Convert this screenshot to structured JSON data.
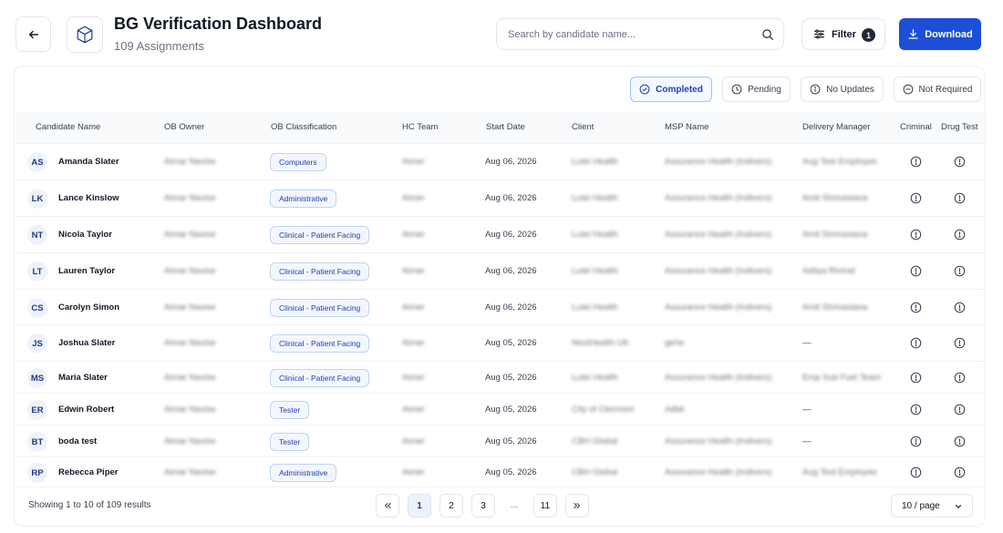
{
  "header": {
    "title": "BG Verification Dashboard",
    "subtitle": "109 Assignments",
    "search_placeholder": "Search by candidate name...",
    "filter_label": "Filter",
    "filter_count": "1",
    "download_label": "Download"
  },
  "status_filters": [
    {
      "label": "Completed",
      "icon": "check-circle-icon",
      "active": true
    },
    {
      "label": "Pending",
      "icon": "clock-icon",
      "active": false
    },
    {
      "label": "No Updates",
      "icon": "info-icon",
      "active": false
    },
    {
      "label": "Not Required",
      "icon": "minus-circle-icon",
      "active": false
    }
  ],
  "columns": [
    "Candidate Name",
    "OB Owner",
    "OB Classification",
    "HC Team",
    "Start Date",
    "Client",
    "MSP Name",
    "Delivery Manager",
    "Criminal",
    "Drug Test"
  ],
  "rows": [
    {
      "initials": "AS",
      "name": "Amanda Slater",
      "ob_owner": "Aimar Navise",
      "classification": "Computers",
      "hc_team": "Aimer",
      "start_date": "Aug 06, 2026",
      "client": "Lutei Health",
      "msp": "Assurance Health (Indivers)",
      "delivery_manager": "Aug Test Employee"
    },
    {
      "initials": "LK",
      "name": "Lance Kinslow",
      "ob_owner": "Aimar Navise",
      "classification": "Administrative",
      "hc_team": "Aimer",
      "start_date": "Aug 06, 2026",
      "client": "Lutei Health",
      "msp": "Assurance Health (Indivers)",
      "delivery_manager": "Amit Shrivastava"
    },
    {
      "initials": "NT",
      "name": "Nicola Taylor",
      "ob_owner": "Aimar Navise",
      "classification": "Clinical - Patient Facing",
      "hc_team": "Aimer",
      "start_date": "Aug 06, 2026",
      "client": "Lutei Health",
      "msp": "Assurance Health (Indivers)",
      "delivery_manager": "Amit Shrivastava"
    },
    {
      "initials": "LT",
      "name": "Lauren Taylor",
      "ob_owner": "Aimar Navise",
      "classification": "Clinical - Patient Facing",
      "hc_team": "Aimer",
      "start_date": "Aug 06, 2026",
      "client": "Lutei Health",
      "msp": "Assurance Health (Indivers)",
      "delivery_manager": "Aditya Rivinal"
    },
    {
      "initials": "CS",
      "name": "Carolyn Simon",
      "ob_owner": "Aimar Navise",
      "classification": "Clinical - Patient Facing",
      "hc_team": "Aimer",
      "start_date": "Aug 06, 2026",
      "client": "Lutei Health",
      "msp": "Assurance Health (Indivers)",
      "delivery_manager": "Amit Shrivastava"
    },
    {
      "initials": "JS",
      "name": "Joshua Slater",
      "ob_owner": "Aimar Navise",
      "classification": "Clinical - Patient Facing",
      "hc_team": "Aimer",
      "start_date": "Aug 05, 2026",
      "client": "NextHealth UK",
      "msp": "gehe",
      "delivery_manager": "—"
    },
    {
      "initials": "MS",
      "name": "Maria Slater",
      "ob_owner": "Aimar Navise",
      "classification": "Clinical - Patient Facing",
      "hc_team": "Aimer",
      "start_date": "Aug 05, 2026",
      "client": "Lutei Health",
      "msp": "Assurance Health (Indivers)",
      "delivery_manager": "Emp Sub Fuel Team"
    },
    {
      "initials": "ER",
      "name": "Edwin Robert",
      "ob_owner": "Aimar Navise",
      "classification": "Tester",
      "hc_team": "Aimer",
      "start_date": "Aug 05, 2026",
      "client": "City of Clermont",
      "msp": "Adlal",
      "delivery_manager": "—"
    },
    {
      "initials": "BT",
      "name": "boda test",
      "ob_owner": "Aimar Navise",
      "classification": "Tester",
      "hc_team": "Aimer",
      "start_date": "Aug 05, 2026",
      "client": "CBH Global",
      "msp": "Assurance Health (Indivers)",
      "delivery_manager": "—"
    },
    {
      "initials": "RP",
      "name": "Rebecca Piper",
      "ob_owner": "Aimar Navise",
      "classification": "Administrative",
      "hc_team": "Aimer",
      "start_date": "Aug 05, 2026",
      "client": "CBH Global",
      "msp": "Assurance Health (Indivers)",
      "delivery_manager": "Aug Test Employee"
    }
  ],
  "footer": {
    "showing": "Showing 1 to 10 of 109 results",
    "pages": [
      "1",
      "2",
      "3",
      "11"
    ],
    "ellipsis": "...",
    "current_page": "1",
    "per_page": "10 / page"
  },
  "colors": {
    "accent": "#1d4ed8",
    "chip_border": "#bfd4f2",
    "chip_text": "#1e40af"
  }
}
